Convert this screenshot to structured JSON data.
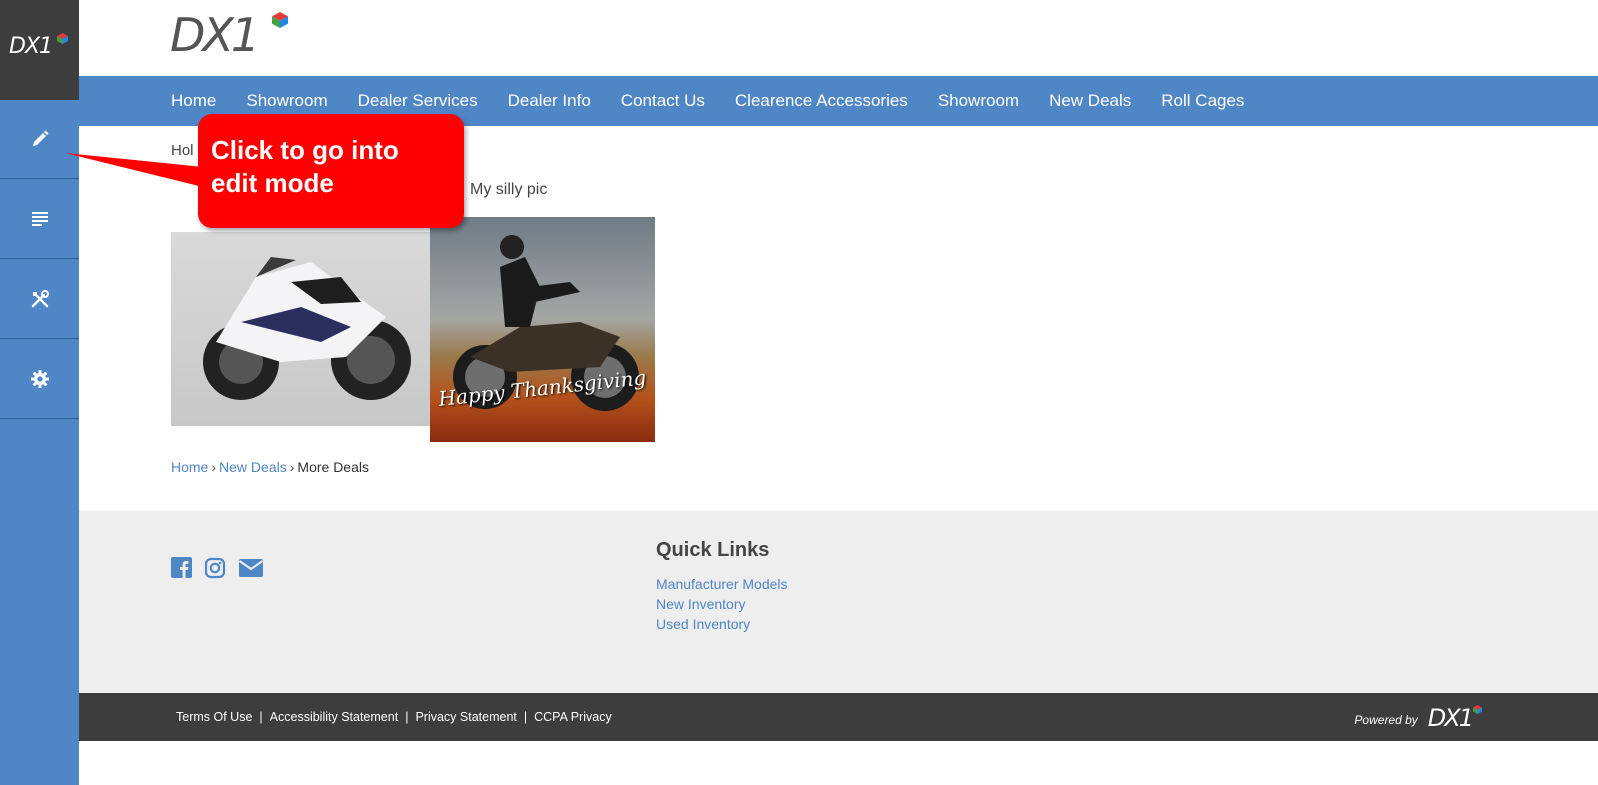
{
  "admin_sidebar": {
    "logo_text": "DX1",
    "buttons": [
      {
        "name": "edit-mode-button",
        "icon": "pencil-icon"
      },
      {
        "name": "content-button",
        "icon": "document-lines-icon"
      },
      {
        "name": "tools-button",
        "icon": "wrench-screwdriver-icon"
      },
      {
        "name": "settings-button",
        "icon": "gear-icon"
      }
    ]
  },
  "header": {
    "logo_text": "DX1",
    "nav": [
      "Home",
      "Showroom",
      "Dealer Services",
      "Dealer Info",
      "Contact Us",
      "Clearence Accessories",
      "Showroom",
      "New Deals",
      "Roll Cages"
    ]
  },
  "content": {
    "partial_breadcrumb": "Hol",
    "image_caption": "My silly pic",
    "thanks_text_line1": "Happy",
    "thanks_text_line2": "Thanksgiving"
  },
  "breadcrumb": {
    "home": "Home",
    "new_deals": "New Deals",
    "current": "More Deals",
    "separator": "›"
  },
  "footer": {
    "social_icons": [
      "facebook-icon",
      "instagram-icon",
      "email-icon"
    ],
    "quick_links_title": "Quick Links",
    "quick_links": [
      "Manufacturer Models",
      "New Inventory",
      "Used Inventory"
    ]
  },
  "legal": {
    "links": [
      "Terms Of Use",
      "Accessibility Statement",
      "Privacy Statement",
      "CCPA Privacy"
    ],
    "separator": "|",
    "powered_by": "Powered by",
    "powered_logo": "DX1"
  },
  "callout": {
    "line1": "Click to go into",
    "line2": "edit mode"
  },
  "colors": {
    "brand_blue": "#4f86c6",
    "dark_bar": "#3d3d3d",
    "callout_red": "#ff0000",
    "footer_bg": "#eeeeee"
  }
}
